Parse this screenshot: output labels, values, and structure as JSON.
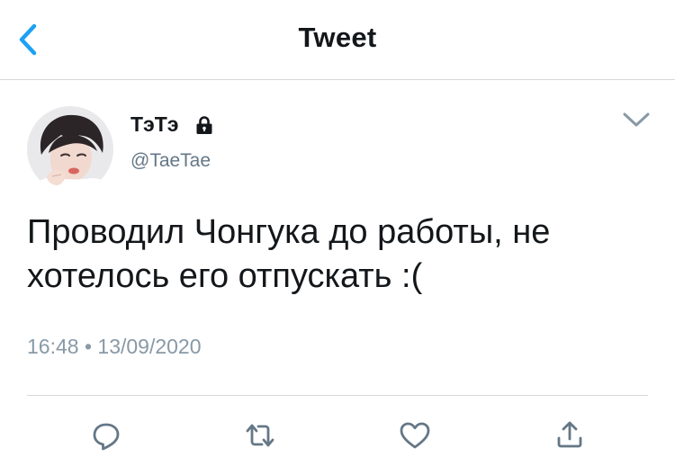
{
  "header": {
    "title": "Tweet"
  },
  "author": {
    "display_name": "ТэТэ",
    "handle": "@TaeTae",
    "protected": true
  },
  "tweet": {
    "text_line1": "Проводил Чонгука до работы, не",
    "text_line2": "хотелось его отпускать :(",
    "time": "16:48",
    "separator": "•",
    "date": "13/09/2020"
  },
  "icons": {
    "back": "chevron-left-icon",
    "lock": "lock-icon",
    "caret": "chevron-down-icon",
    "reply": "reply-icon",
    "retweet": "retweet-icon",
    "like": "heart-icon",
    "share": "share-icon"
  },
  "colors": {
    "accent": "#1da1f2",
    "text": "#14171a",
    "secondary": "#657786",
    "icon": "#657786",
    "divider": "#d6d9dc"
  }
}
